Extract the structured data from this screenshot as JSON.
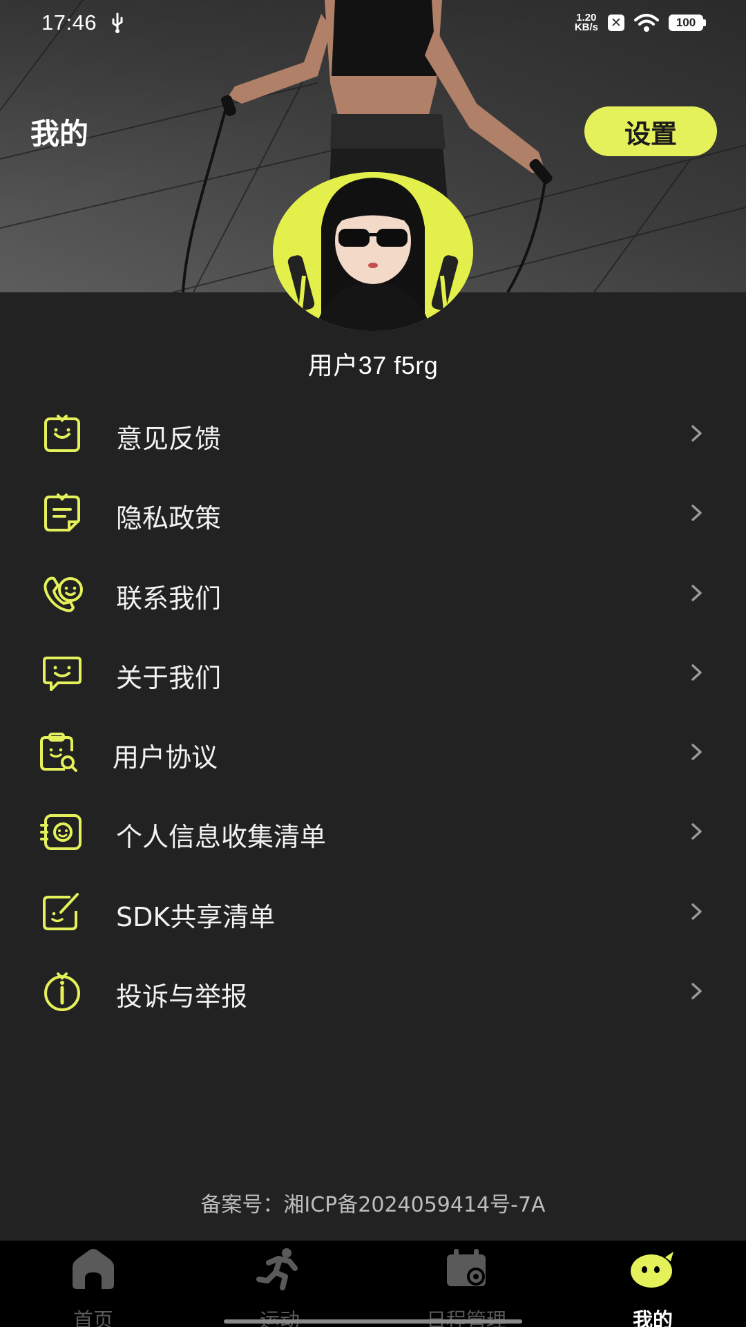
{
  "status_bar": {
    "time": "17:46",
    "net_speed_value": "1.20",
    "net_speed_unit": "KB/s",
    "battery": "100",
    "icons": [
      "usb-icon",
      "x-notification-icon",
      "wifi-icon",
      "battery-icon"
    ]
  },
  "header": {
    "title": "我的",
    "settings_label": "设置"
  },
  "profile": {
    "username": "用户37  f5rg"
  },
  "menu": {
    "items": [
      {
        "label": "意见反馈",
        "icon": "feedback-icon"
      },
      {
        "label": "隐私政策",
        "icon": "privacy-policy-icon"
      },
      {
        "label": "联系我们",
        "icon": "phone-icon"
      },
      {
        "label": "关于我们",
        "icon": "chat-bubble-icon"
      },
      {
        "label": "用户协议",
        "icon": "agreement-search-icon"
      },
      {
        "label": "个人信息收集清单",
        "icon": "personal-info-icon"
      },
      {
        "label": "SDK共享清单",
        "icon": "checklist-icon"
      },
      {
        "label": "投诉与举报",
        "icon": "info-icon"
      }
    ]
  },
  "footer": {
    "icp": "备案号：湘ICP备2024059414号-7A"
  },
  "tab_bar": {
    "tabs": [
      {
        "label": "首页",
        "icon": "home-icon",
        "active": false
      },
      {
        "label": "运动",
        "icon": "running-icon",
        "active": false
      },
      {
        "label": "日程管理",
        "icon": "calendar-icon",
        "active": false
      },
      {
        "label": "我的",
        "icon": "mine-face-icon",
        "active": true
      }
    ]
  },
  "colors": {
    "accent": "#e4f15a",
    "background": "#222222",
    "tab_bar_bg": "#000000",
    "inactive_tab": "#5a5a5a"
  }
}
